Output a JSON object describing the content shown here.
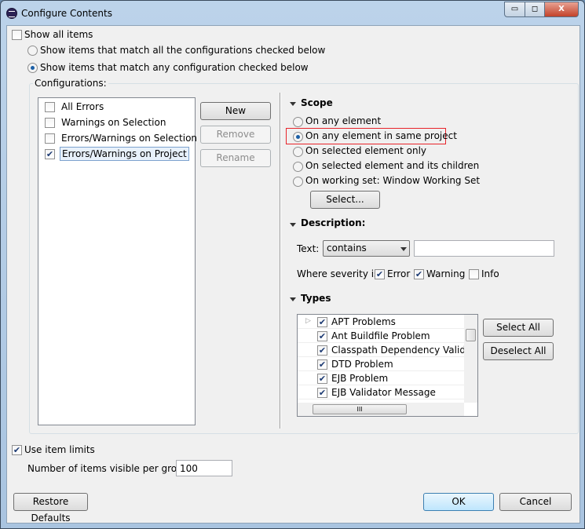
{
  "window": {
    "title": "Configure Contents",
    "minimize": "▭",
    "maximize": "◻",
    "close": "X"
  },
  "show_all": {
    "label": "Show all items",
    "checked": false
  },
  "match_all": {
    "label": "Show items that match all the configurations checked below",
    "selected": false
  },
  "match_any": {
    "label": "Show items that match any configuration checked below",
    "selected": true
  },
  "configurations": {
    "label": "Configurations:",
    "items": [
      {
        "label": "All Errors",
        "checked": false
      },
      {
        "label": "Warnings on Selection",
        "checked": false
      },
      {
        "label": "Errors/Warnings on Selection",
        "checked": false
      },
      {
        "label": "Errors/Warnings on Project",
        "checked": true,
        "selected": true
      }
    ],
    "new": "New",
    "remove": "Remove",
    "rename": "Rename"
  },
  "scope": {
    "label": "Scope",
    "options": [
      {
        "label": "On any element",
        "selected": false
      },
      {
        "label": "On any element in same project",
        "selected": true
      },
      {
        "label": "On selected element only",
        "selected": false
      },
      {
        "label": "On selected element and its children",
        "selected": false
      },
      {
        "label": "On working set:  Window Working Set",
        "selected": false
      }
    ],
    "select_button": "Select..."
  },
  "description": {
    "label": "Description:",
    "text_label": "Text:",
    "mode": "contains",
    "text_value": "",
    "severity_label": "Where severity is:",
    "error": "Error",
    "warning": "Warning",
    "info": "Info"
  },
  "types": {
    "label": "Types",
    "items": [
      "APT Problems",
      "Ant Buildfile Problem",
      "Classpath Dependency Validator",
      "DTD Problem",
      "EJB Problem",
      "EJB Validator Message"
    ],
    "select_all": "Select All",
    "deselect_all": "Deselect All",
    "hscroll_grip": "III"
  },
  "limits": {
    "label": "Use item limits",
    "checked": true,
    "count_label": "Number of items visible per group:",
    "count": "100"
  },
  "footer": {
    "restore": "Restore Defaults",
    "ok": "OK",
    "cancel": "Cancel"
  },
  "colors": {
    "highlight": "#e8242a",
    "focus": "#3c7fb1"
  }
}
